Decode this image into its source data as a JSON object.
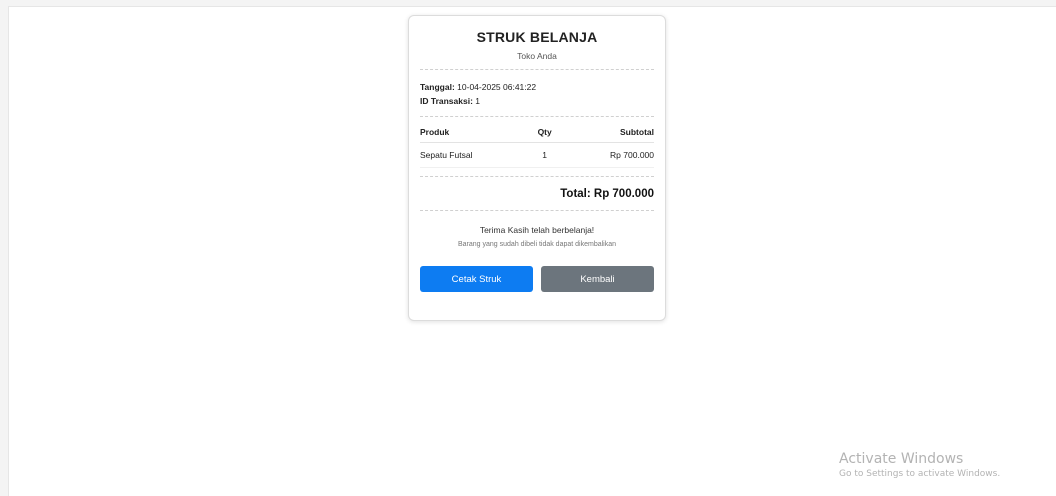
{
  "receipt": {
    "title": "STRUK BELANJA",
    "store_name": "Toko Anda",
    "date_label": "Tanggal:",
    "date_value": "10-04-2025 06:41:22",
    "transaction_label": "ID Transaksi:",
    "transaction_value": "1",
    "columns": {
      "product": "Produk",
      "qty": "Qty",
      "subtotal": "Subtotal"
    },
    "items": [
      {
        "product": "Sepatu Futsal",
        "qty": "1",
        "subtotal": "Rp 700.000"
      }
    ],
    "total": "Total: Rp 700.000",
    "thanks": "Terima Kasih telah berbelanja!",
    "note": "Barang yang sudah dibeli tidak dapat dikembalikan",
    "print_button": "Cetak Struk",
    "back_button": "Kembali"
  },
  "watermark": {
    "title": "Activate Windows",
    "subtitle": "Go to Settings to activate Windows."
  },
  "colors": {
    "primary": "#0d7cf2",
    "secondary": "#6c757d"
  }
}
